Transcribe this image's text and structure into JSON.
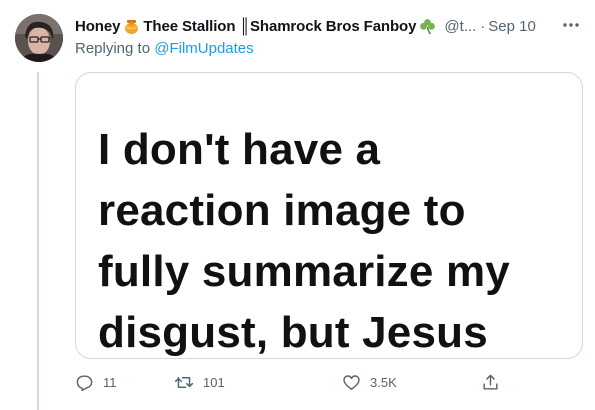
{
  "tweet": {
    "author": {
      "display_name_part1": "Honey",
      "emoji1": "honey-pot-icon",
      "display_name_part2": "Thee Stallion ║Shamrock Bros Fanboy",
      "emoji2": "shamrock-icon",
      "handle": "@t...",
      "avatar": "avatar"
    },
    "separator": "·",
    "date": "Sep 10",
    "reply_prefix": "Replying to",
    "reply_mention": "@FilmUpdates",
    "media_text_lines": [
      "I don't have a",
      "reaction image to",
      "fully summarize my",
      "disgust, but Jesus"
    ],
    "actions": {
      "reply_count": "11",
      "retweet_count": "101",
      "like_count": "3.5K"
    }
  }
}
